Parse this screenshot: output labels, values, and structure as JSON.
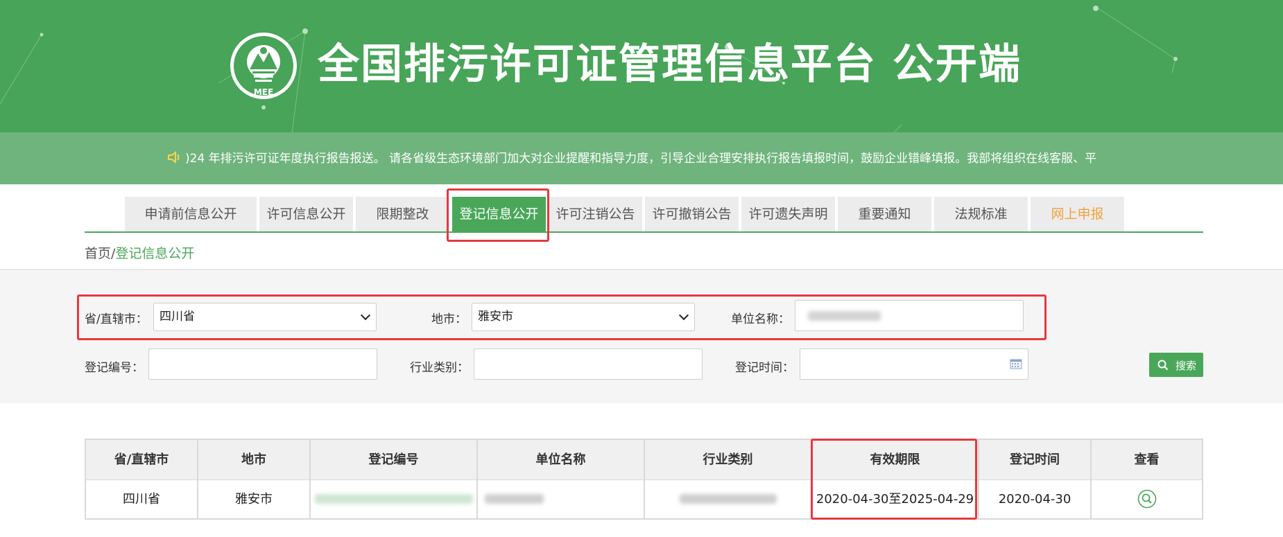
{
  "header": {
    "site_title": "全国排污许可证管理信息平台  公开端",
    "logo_text": "MEE",
    "notice_text": ")24 年排污许可证年度执行报告报送。 请各省级生态环境部门加大对企业提醒和指导力度，引导企业合理安排执行报告填报时间，鼓励企业错峰填报。我部将组织在线客服、平"
  },
  "nav": {
    "items": [
      {
        "label": "申请前信息公开"
      },
      {
        "label": "许可信息公开"
      },
      {
        "label": "限期整改"
      },
      {
        "label": "登记信息公开"
      },
      {
        "label": "许可注销公告"
      },
      {
        "label": "许可撤销公告"
      },
      {
        "label": "许可遗失声明"
      },
      {
        "label": "重要通知"
      },
      {
        "label": "法规标准"
      },
      {
        "label": "网上申报"
      }
    ],
    "active_index": 3
  },
  "breadcrumb": {
    "home": "首页",
    "separator": "/",
    "current": "登记信息公开"
  },
  "filters": {
    "province_label": "省/直辖市：",
    "province_value": "四川省",
    "city_label": "地市：",
    "city_value": "雅安市",
    "unit_label": "单位名称：",
    "reg_no_label": "登记编号：",
    "industry_label": "行业类别：",
    "reg_time_label": "登记时间：",
    "search_label": "搜索"
  },
  "table": {
    "headers": [
      "省/直辖市",
      "地市",
      "登记编号",
      "单位名称",
      "行业类别",
      "有效期限",
      "登记时间",
      "查看"
    ],
    "rows": [
      {
        "province": "四川省",
        "city": "雅安市",
        "valid_period": "2020-04-30至2025-04-29",
        "reg_time": "2020-04-30"
      }
    ]
  },
  "colors": {
    "header_green": "#47a458",
    "accent_green": "#4aa75a",
    "highlight_red": "#e33a3f",
    "report_orange": "#f2a23a"
  }
}
